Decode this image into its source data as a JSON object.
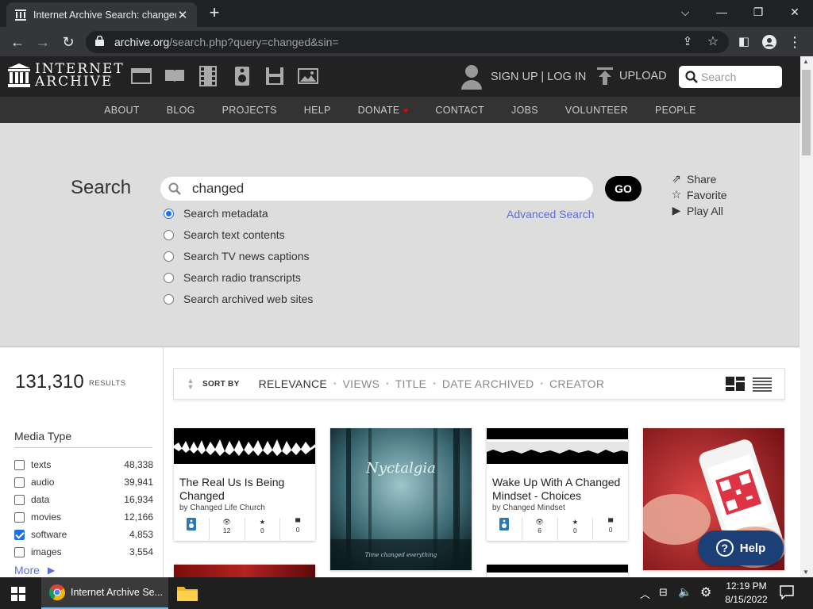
{
  "browser": {
    "tab_title": "Internet Archive Search: changed",
    "url_host": "archive.org",
    "url_path": "/search.php?query=changed&sin="
  },
  "header": {
    "logo_line1": "INTERNET",
    "logo_line2": "ARCHIVE",
    "signup_label": "SIGN UP | LOG IN",
    "upload_label": "UPLOAD",
    "search_placeholder": "Search"
  },
  "nav": {
    "items": [
      "ABOUT",
      "BLOG",
      "PROJECTS",
      "HELP",
      "DONATE",
      "CONTACT",
      "JOBS",
      "VOLUNTEER",
      "PEOPLE"
    ]
  },
  "search": {
    "title": "Search",
    "query": "changed",
    "go_label": "GO",
    "advanced_label": "Advanced Search",
    "options": [
      {
        "label": "Search metadata",
        "selected": true
      },
      {
        "label": "Search text contents",
        "selected": false
      },
      {
        "label": "Search TV news captions",
        "selected": false
      },
      {
        "label": "Search radio transcripts",
        "selected": false
      },
      {
        "label": "Search archived web sites",
        "selected": false
      }
    ],
    "share_label": "Share",
    "favorite_label": "Favorite",
    "playall_label": "Play All"
  },
  "results": {
    "count": "131,310",
    "count_label": "RESULTS",
    "sort_label": "SORT BY",
    "sort_options": [
      "RELEVANCE",
      "VIEWS",
      "TITLE",
      "DATE ARCHIVED",
      "CREATOR"
    ],
    "active_sort": "RELEVANCE"
  },
  "facets": {
    "heading": "Media Type",
    "items": [
      {
        "label": "texts",
        "count": "48,338",
        "checked": false
      },
      {
        "label": "audio",
        "count": "39,941",
        "checked": false
      },
      {
        "label": "data",
        "count": "16,934",
        "checked": false
      },
      {
        "label": "movies",
        "count": "12,166",
        "checked": false
      },
      {
        "label": "software",
        "count": "4,853",
        "checked": true
      },
      {
        "label": "images",
        "count": "3,554",
        "checked": false
      }
    ],
    "more_label": "More"
  },
  "tiles": [
    {
      "title": "The Real Us Is Being Changed",
      "by": "by Changed Life Church",
      "views": "12",
      "favs": "0",
      "reviews": "0"
    },
    {
      "image_text": "Nyctalgia",
      "caption": "Time changed everything"
    },
    {
      "title": "Wake Up With A Changed Mindset - Choices",
      "by": "by Changed Mindset",
      "views": "6",
      "favs": "0",
      "reviews": "0"
    },
    {
      "kind": "photo"
    }
  ],
  "help": {
    "label": "Help"
  },
  "taskbar": {
    "app_label": "Internet Archive Se...",
    "time": "12:19 PM",
    "date": "8/15/2022"
  },
  "colors": {
    "ia_header": "#222222",
    "ia_subnav": "#333333",
    "panel_bg": "#dddddd",
    "link": "#5b6fd6",
    "help_bg": "#1c3f78"
  }
}
